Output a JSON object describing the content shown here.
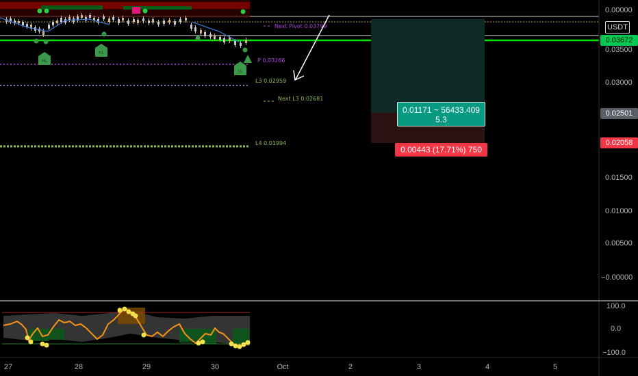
{
  "symbol_currency": "USDT",
  "price_axis": {
    "ticks": [
      "0.00000",
      "0.03500",
      "0.03000",
      "0.02500",
      "0.02000",
      "0.01500",
      "0.01000",
      "0.00500",
      "−0.00000"
    ],
    "current_price_tag": "0.03672",
    "target_price_tag": "0.02501",
    "stop_price_tag": "0.02058"
  },
  "levels": {
    "next_pivot": "Next Pivot 0.03799",
    "p": "P 0.03266",
    "l3": "L3 0.02959",
    "next_l3": "Next L3 0.02681",
    "l4": "L4 0.01994"
  },
  "markers": {
    "hl1": "HL",
    "hl2": "HL",
    "ll": "LL"
  },
  "position_tool": {
    "target_line1": "0.01171 ~ 56433.409",
    "target_line2": "5.3",
    "stop_label": "0.00443 (17.71%) 750"
  },
  "oscillator_axis": {
    "ticks": [
      "100.0",
      "0.0",
      "−100.0"
    ]
  },
  "time_axis": {
    "ticks": [
      "27",
      "28",
      "29",
      "30",
      "Oct",
      "2",
      "3",
      "4",
      "5"
    ]
  },
  "colors": {
    "background": "#000000",
    "green_line": "#00e600",
    "target_zone": "#0d2a26",
    "stop_zone": "#2a1212",
    "target_badge": "#089981",
    "stop_badge": "#f23645",
    "pivot_purple": "#b23fe0",
    "level_green": "#8fbc5a",
    "oscillator_line": "#f7931a"
  }
}
